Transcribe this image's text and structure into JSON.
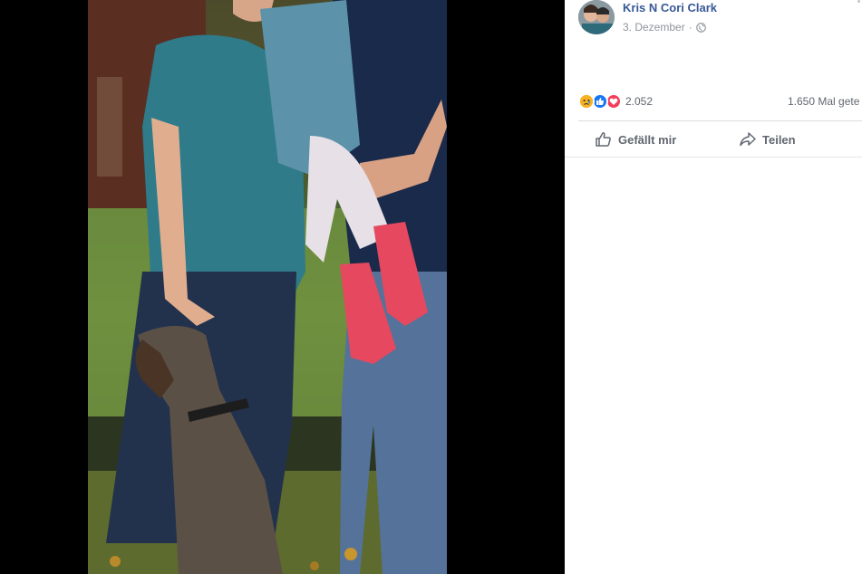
{
  "post": {
    "author": "Kris N Cori Clark",
    "date": "3. Dezember",
    "privacy_icon": "globe-icon"
  },
  "reactions": {
    "icons": [
      "sad-reaction-icon",
      "like-reaction-icon",
      "love-reaction-icon"
    ],
    "count": "2.052",
    "shares": "1.650 Mal gete"
  },
  "actions": {
    "like_label": "Gefällt mir",
    "share_label": "Teilen"
  },
  "colors": {
    "author_link": "#385898",
    "meta_text": "#90949c",
    "action_text": "#606770",
    "like_blue": "#1877f2",
    "love_red": "#f33e58",
    "sad_yellow": "#f7b125"
  }
}
